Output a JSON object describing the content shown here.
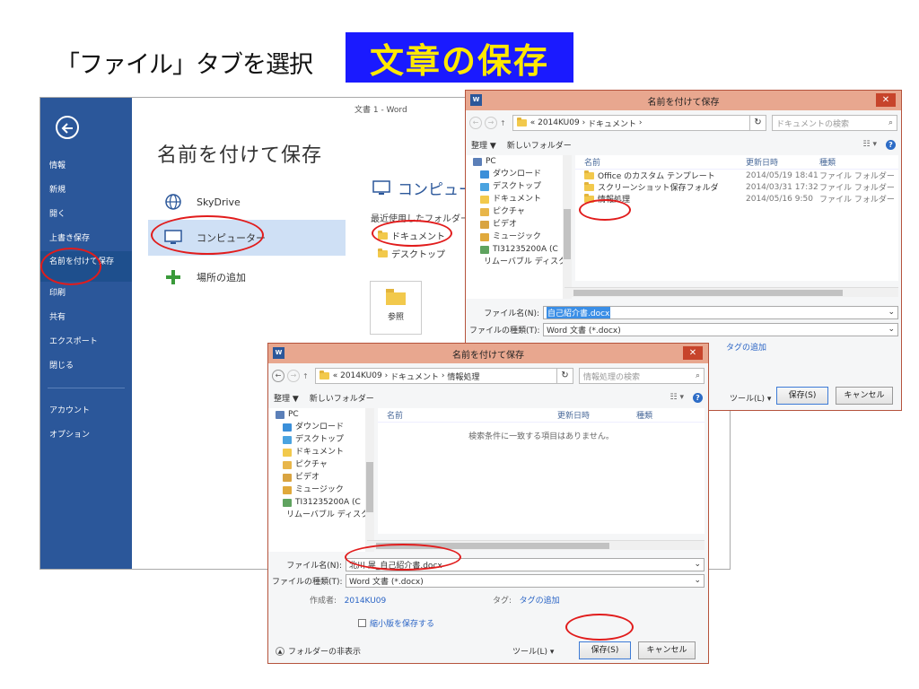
{
  "slide": {
    "title": "「ファイル」タブを選択",
    "badge": "文章の保存"
  },
  "backstage": {
    "doc_title": "文書 1 - Word",
    "heading": "名前を付けて保存",
    "menu": [
      "情報",
      "新規",
      "開く",
      "上書き保存",
      "名前を付けて保存",
      "印刷",
      "共有",
      "エクスポート",
      "閉じる",
      "アカウント",
      "オプション"
    ],
    "places": {
      "skydrive": "SkyDrive",
      "computer": "コンピューター",
      "add_place": "場所の追加"
    },
    "computer_heading": "コンピューター",
    "recent_label": "最近使用したフォルダー",
    "recent_folders": [
      "ドキュメント",
      "デスクトップ"
    ],
    "browse": "参照"
  },
  "dialog_back": {
    "title": "名前を付けて保存",
    "breadcrumb": [
      "«",
      "2014KU09",
      "ドキュメント"
    ],
    "search_placeholder": "ドキュメントの検索",
    "organize": "整理 ▼",
    "new_folder": "新しいフォルダー",
    "tree": [
      "PC",
      "ダウンロード",
      "デスクトップ",
      "ドキュメント",
      "ピクチャ",
      "ビデオ",
      "ミュージック",
      "TI31235200A (C",
      "リムーバブル ディスク"
    ],
    "columns": [
      "名前",
      "更新日時",
      "種類"
    ],
    "files": [
      {
        "name": "Office のカスタム テンプレート",
        "date": "2014/05/19 18:41",
        "type": "ファイル フォルダー"
      },
      {
        "name": "スクリーンショット保存フォルダ",
        "date": "2014/03/31 17:32",
        "type": "ファイル フォルダー"
      },
      {
        "name": "情報処理",
        "date": "2014/05/16 9:50",
        "type": "ファイル フォルダー"
      }
    ],
    "filename_label": "ファイル名(N):",
    "filename_value": "自己紹介書.docx",
    "filetype_label": "ファイルの種類(T):",
    "filetype_value": "Word 文書 (*.docx)",
    "tag_text": "タグの追加",
    "tools": "ツール(L)",
    "save": "保存(S)",
    "cancel": "キャンセル"
  },
  "dialog_front": {
    "title": "名前を付けて保存",
    "breadcrumb": [
      "«",
      "2014KU09",
      "ドキュメント",
      "情報処理"
    ],
    "search_placeholder": "情報処理の検索",
    "organize": "整理 ▼",
    "new_folder": "新しいフォルダー",
    "tree": [
      "PC",
      "ダウンロード",
      "デスクトップ",
      "ドキュメント",
      "ピクチャ",
      "ビデオ",
      "ミュージック",
      "TI31235200A (C",
      "リムーバブル ディスク"
    ],
    "columns": [
      "名前",
      "更新日時",
      "種類"
    ],
    "empty_message": "検索条件に一致する項目はありません。",
    "filename_label": "ファイル名(N):",
    "filename_value": "北川 晃_自己紹介書.docx",
    "filetype_label": "ファイルの種類(T):",
    "filetype_value": "Word 文書 (*.docx)",
    "author_label": "作成者:",
    "author_value": "2014KU09",
    "tag_label": "タグ:",
    "tag_value": "タグの追加",
    "thumbnail_label": "縮小版を保存する",
    "hide_folders": "フォルダーの非表示",
    "tools": "ツール(L)",
    "save": "保存(S)",
    "cancel": "キャンセル"
  },
  "colors": {
    "word_blue": "#2b579a",
    "badge_blue": "#1a1aff",
    "badge_yellow": "#ffe800",
    "highlight_red": "#e11c1c",
    "titlebar": "#e8a78f"
  }
}
